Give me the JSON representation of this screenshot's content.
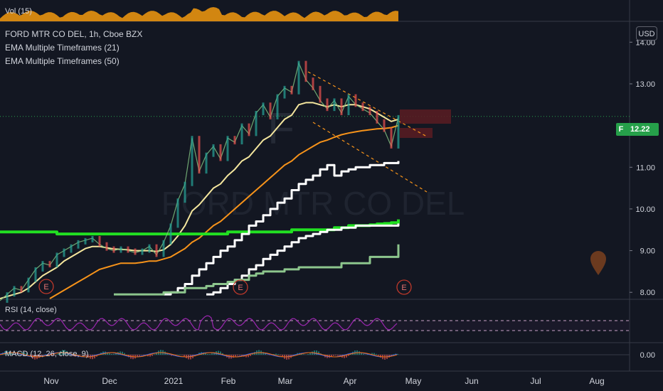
{
  "header": {
    "symbol_line": "FORD MTR CO DEL, 1h, Cboe BZX",
    "indicator_1": "EMA Multiple Timeframes (21)",
    "indicator_2": "EMA Multiple Timeframes (50)",
    "volume_label": "Vol (15)",
    "rsi_label": "RSI (14, close)",
    "macd_label": "MACD (12, 26, close, 9)",
    "currency_button": "USD"
  },
  "watermark": {
    "ticker": "F",
    "name": "FORD MTR CO DEL"
  },
  "last_price": {
    "symbol": "F",
    "value": "12.22"
  },
  "chart_data": {
    "type": "line",
    "x_ticks": [
      "Nov",
      "Dec",
      "2021",
      "Feb",
      "Mar",
      "Apr",
      "May",
      "Jun",
      "Jul",
      "Aug"
    ],
    "y_ticks": [
      "14.00",
      "13.00",
      "12.00",
      "11.00",
      "10.00",
      "9.00",
      "8.00"
    ],
    "ylim": [
      7.85,
      14.5
    ],
    "macd_ticks": [
      "0.00"
    ],
    "last_price": 12.22,
    "earnings_markers": [
      "E",
      "E",
      "E"
    ],
    "price_x": [
      0,
      10,
      20,
      30,
      40,
      50,
      60,
      70,
      80,
      90,
      100,
      110,
      120,
      130,
      140,
      150,
      160,
      170,
      180,
      190,
      200,
      210,
      220,
      230,
      240,
      250,
      260,
      270,
      280,
      290,
      300,
      310,
      320,
      330,
      340,
      350,
      360,
      370,
      380,
      390,
      400,
      410,
      420,
      430,
      440,
      450,
      460,
      470,
      480,
      490,
      500,
      510,
      520,
      530,
      540,
      550,
      560
    ],
    "price_y": [
      7.8,
      7.95,
      8.1,
      8.05,
      8.3,
      8.55,
      8.7,
      8.65,
      8.9,
      9.0,
      9.1,
      9.2,
      9.25,
      9.3,
      9.15,
      9.05,
      9.0,
      9.05,
      9.0,
      8.95,
      9.0,
      9.1,
      8.9,
      9.2,
      9.6,
      10.2,
      10.6,
      11.7,
      10.9,
      11.3,
      11.5,
      11.2,
      11.7,
      11.6,
      12.0,
      11.8,
      12.3,
      12.5,
      12.2,
      12.7,
      12.9,
      12.8,
      13.5,
      13.1,
      12.9,
      12.6,
      12.4,
      12.6,
      12.3,
      12.7,
      12.5,
      12.4,
      12.3,
      12.1,
      11.9,
      11.5,
      12.2
    ],
    "series": [
      {
        "color": "#f5e79e",
        "values": [
          7.85,
          7.9,
          7.95,
          8.0,
          8.1,
          8.25,
          8.4,
          8.5,
          8.6,
          8.75,
          8.85,
          8.95,
          9.05,
          9.1,
          9.1,
          9.07,
          9.04,
          9.03,
          9.02,
          9.0,
          9.0,
          9.0,
          8.98,
          9.02,
          9.15,
          9.35,
          9.6,
          9.95,
          10.1,
          10.3,
          10.5,
          10.6,
          10.8,
          10.95,
          11.15,
          11.25,
          11.45,
          11.65,
          11.75,
          11.95,
          12.15,
          12.25,
          12.5,
          12.55,
          12.55,
          12.5,
          12.45,
          12.5,
          12.45,
          12.5,
          12.5,
          12.45,
          12.4,
          12.3,
          12.2,
          12.1,
          12.15
        ]
      },
      {
        "color": "#f7931a",
        "values": [
          null,
          null,
          null,
          null,
          null,
          null,
          null,
          7.85,
          7.95,
          8.05,
          8.15,
          8.25,
          8.35,
          8.45,
          8.55,
          8.6,
          8.65,
          8.7,
          8.7,
          8.7,
          8.72,
          8.75,
          8.75,
          8.8,
          8.85,
          8.95,
          9.05,
          9.2,
          9.3,
          9.45,
          9.6,
          9.7,
          9.85,
          10.0,
          10.15,
          10.3,
          10.45,
          10.6,
          10.75,
          10.9,
          11.05,
          11.15,
          11.3,
          11.4,
          11.5,
          11.6,
          11.65,
          11.72,
          11.78,
          11.82,
          11.85,
          11.88,
          11.9,
          11.92,
          11.93,
          11.95,
          12.0
        ]
      },
      {
        "color": "#22e022",
        "values": [
          9.45,
          9.45,
          9.45,
          9.45,
          9.45,
          9.45,
          9.45,
          9.45,
          9.4,
          9.4,
          9.4,
          9.4,
          9.4,
          9.4,
          9.4,
          9.4,
          9.4,
          9.4,
          9.4,
          9.4,
          9.4,
          9.4,
          9.4,
          9.4,
          9.4,
          9.4,
          9.4,
          9.4,
          9.4,
          9.4,
          9.4,
          9.4,
          9.45,
          9.45,
          9.45,
          9.45,
          9.45,
          9.45,
          9.45,
          9.45,
          9.45,
          9.5,
          9.5,
          9.5,
          9.5,
          9.5,
          9.5,
          9.55,
          9.55,
          9.6,
          9.6,
          9.6,
          9.62,
          9.64,
          9.65,
          9.67,
          9.75
        ]
      },
      {
        "color": "#ffffff",
        "values": [
          null,
          null,
          null,
          null,
          null,
          null,
          null,
          null,
          null,
          null,
          null,
          null,
          null,
          null,
          null,
          null,
          null,
          null,
          null,
          null,
          null,
          null,
          null,
          7.95,
          8.0,
          8.1,
          8.2,
          8.4,
          8.55,
          8.7,
          8.85,
          9.0,
          9.1,
          9.25,
          9.4,
          9.6,
          9.7,
          9.85,
          10.0,
          10.15,
          10.25,
          10.45,
          10.6,
          10.7,
          10.8,
          10.95,
          11.05,
          10.8,
          10.9,
          10.95,
          11.0,
          11.0,
          11.05,
          11.05,
          11.1,
          11.1,
          11.15
        ]
      },
      {
        "color": "#ffffff",
        "values": [
          null,
          null,
          null,
          null,
          null,
          null,
          null,
          null,
          null,
          null,
          null,
          null,
          null,
          null,
          null,
          null,
          null,
          null,
          null,
          null,
          null,
          null,
          null,
          null,
          null,
          null,
          null,
          null,
          null,
          7.95,
          8.0,
          8.1,
          8.2,
          8.3,
          8.4,
          8.55,
          8.65,
          8.8,
          8.9,
          9.0,
          9.1,
          9.2,
          9.3,
          9.35,
          9.4,
          9.45,
          9.5,
          9.5,
          9.55,
          9.55,
          9.6,
          9.6,
          9.6,
          9.6,
          9.6,
          9.6,
          9.65
        ]
      },
      {
        "color": "#8dc68d",
        "values": [
          null,
          null,
          null,
          null,
          null,
          null,
          null,
          null,
          null,
          null,
          null,
          null,
          null,
          null,
          null,
          null,
          7.95,
          7.95,
          7.95,
          7.95,
          7.95,
          7.95,
          7.95,
          8.0,
          8.0,
          8.0,
          8.1,
          8.1,
          8.1,
          8.15,
          8.2,
          8.2,
          8.25,
          8.3,
          8.3,
          8.4,
          8.45,
          8.5,
          8.5,
          8.5,
          8.55,
          8.55,
          8.6,
          8.6,
          8.6,
          8.6,
          8.6,
          8.6,
          8.7,
          8.7,
          8.7,
          8.7,
          8.85,
          8.85,
          8.85,
          8.85,
          9.15
        ]
      }
    ]
  }
}
